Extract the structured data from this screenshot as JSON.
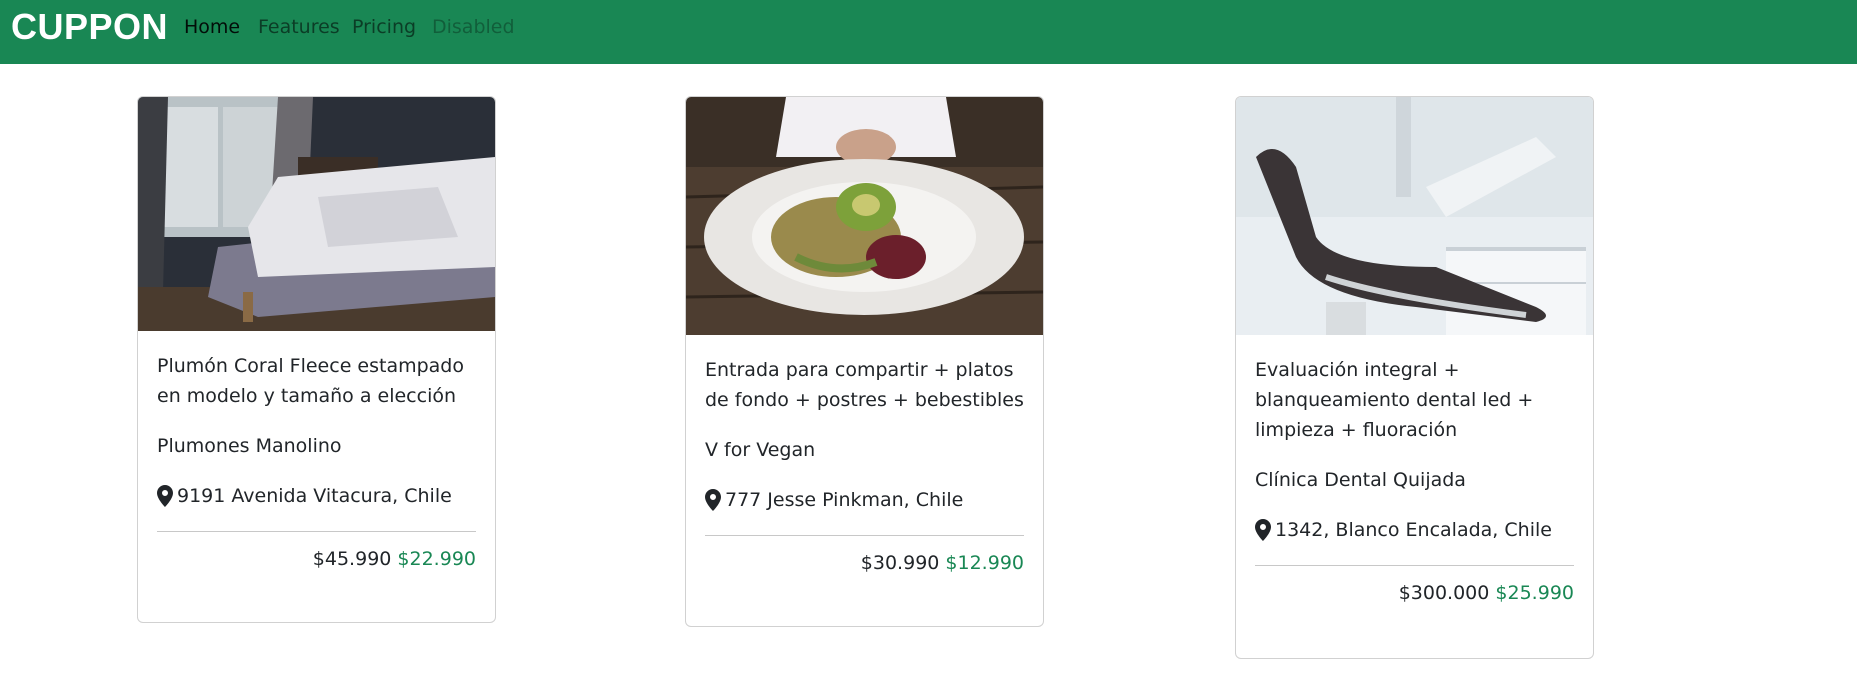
{
  "navbar": {
    "brand": "CUPPON",
    "links": [
      {
        "label": "Home"
      },
      {
        "label": "Features"
      },
      {
        "label": "Pricing"
      },
      {
        "label": "Disabled"
      }
    ]
  },
  "colors": {
    "brand_green": "#198754",
    "sale_price_green": "#198754"
  },
  "cards": [
    {
      "image_alt": "bedroom photo",
      "title": "Plumón Coral Fleece estampado en modelo y tamaño a elección",
      "vendor": "Plumones Manolino",
      "address_icon": "map-pin-icon",
      "address": "9191 Avenida Vitacura, Chile",
      "original_price": "$45.990",
      "sale_price": "$22.990"
    },
    {
      "image_alt": "salad plate photo",
      "title": "Entrada para compartir + platos de fondo + postres + bebestibles",
      "vendor": "V for Vegan",
      "address_icon": "map-pin-icon",
      "address": "777 Jesse Pinkman, Chile",
      "original_price": "$30.990",
      "sale_price": "$12.990"
    },
    {
      "image_alt": "dental chair photo",
      "title": "Evaluación integral + blanqueamiento dental led + limpieza + fluoración",
      "vendor": "Clínica Dental Quijada",
      "address_icon": "map-pin-icon",
      "address": "1342, Blanco Encalada, Chile",
      "original_price": "$300.000",
      "sale_price": "$25.990"
    }
  ]
}
